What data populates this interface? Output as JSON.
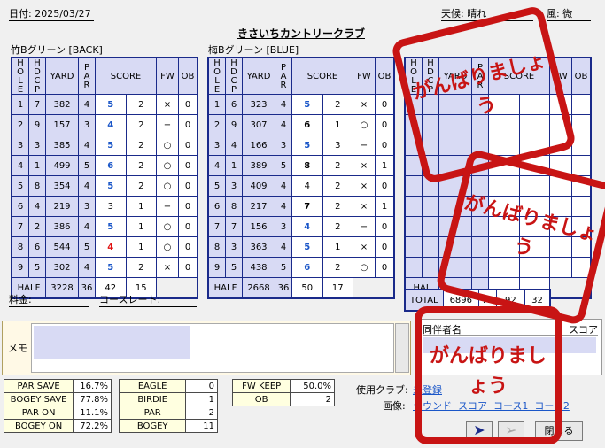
{
  "header": {
    "date_label": "日付: 2025/03/27",
    "title": "きさいちカントリークラブ",
    "weather_label": "天候: 晴れ",
    "wind_label": "風: 微"
  },
  "course1": {
    "name": "竹Bグリーン [BACK]",
    "rows": [
      {
        "hole": "1",
        "hdcp": "7",
        "yard": "382",
        "par": "4",
        "score": "5",
        "putt": "2",
        "fw": "×",
        "ob": "0",
        "score_style": "blue"
      },
      {
        "hole": "2",
        "hdcp": "9",
        "yard": "157",
        "par": "3",
        "score": "4",
        "putt": "2",
        "fw": "−",
        "ob": "0",
        "score_style": "blue"
      },
      {
        "hole": "3",
        "hdcp": "3",
        "yard": "385",
        "par": "4",
        "score": "5",
        "putt": "2",
        "fw": "○",
        "ob": "0",
        "score_style": "blue"
      },
      {
        "hole": "4",
        "hdcp": "1",
        "yard": "499",
        "par": "5",
        "score": "6",
        "putt": "2",
        "fw": "○",
        "ob": "0",
        "score_style": "blue"
      },
      {
        "hole": "5",
        "hdcp": "8",
        "yard": "354",
        "par": "4",
        "score": "5",
        "putt": "2",
        "fw": "○",
        "ob": "0",
        "score_style": "blue"
      },
      {
        "hole": "6",
        "hdcp": "4",
        "yard": "219",
        "par": "3",
        "score": "3",
        "putt": "1",
        "fw": "−",
        "ob": "0",
        "score_style": "plain"
      },
      {
        "hole": "7",
        "hdcp": "2",
        "yard": "386",
        "par": "4",
        "score": "5",
        "putt": "1",
        "fw": "○",
        "ob": "0",
        "score_style": "blue"
      },
      {
        "hole": "8",
        "hdcp": "6",
        "yard": "544",
        "par": "5",
        "score": "4",
        "putt": "1",
        "fw": "○",
        "ob": "0",
        "score_style": "red"
      },
      {
        "hole": "9",
        "hdcp": "5",
        "yard": "302",
        "par": "4",
        "score": "5",
        "putt": "2",
        "fw": "×",
        "ob": "0",
        "score_style": "blue"
      }
    ],
    "half": {
      "label": "HALF",
      "yard": "3228",
      "par": "36",
      "score": "42",
      "putt": "15"
    }
  },
  "course2": {
    "name": "梅Bグリーン [BLUE]",
    "rows": [
      {
        "hole": "1",
        "hdcp": "6",
        "yard": "323",
        "par": "4",
        "score": "5",
        "putt": "2",
        "fw": "×",
        "ob": "0",
        "score_style": "blue"
      },
      {
        "hole": "2",
        "hdcp": "9",
        "yard": "307",
        "par": "4",
        "score": "6",
        "putt": "1",
        "fw": "○",
        "ob": "0",
        "score_style": "navy"
      },
      {
        "hole": "3",
        "hdcp": "4",
        "yard": "166",
        "par": "3",
        "score": "5",
        "putt": "3",
        "fw": "−",
        "ob": "0",
        "score_style": "blue"
      },
      {
        "hole": "4",
        "hdcp": "1",
        "yard": "389",
        "par": "5",
        "score": "8",
        "putt": "2",
        "fw": "×",
        "ob": "1",
        "score_style": "bold"
      },
      {
        "hole": "5",
        "hdcp": "3",
        "yard": "409",
        "par": "4",
        "score": "4",
        "putt": "2",
        "fw": "×",
        "ob": "0",
        "score_style": "plain"
      },
      {
        "hole": "6",
        "hdcp": "8",
        "yard": "217",
        "par": "4",
        "score": "7",
        "putt": "2",
        "fw": "×",
        "ob": "1",
        "score_style": "bold"
      },
      {
        "hole": "7",
        "hdcp": "7",
        "yard": "156",
        "par": "3",
        "score": "4",
        "putt": "2",
        "fw": "−",
        "ob": "0",
        "score_style": "blue"
      },
      {
        "hole": "8",
        "hdcp": "3",
        "yard": "363",
        "par": "4",
        "score": "5",
        "putt": "1",
        "fw": "×",
        "ob": "0",
        "score_style": "blue"
      },
      {
        "hole": "9",
        "hdcp": "5",
        "yard": "438",
        "par": "5",
        "score": "6",
        "putt": "2",
        "fw": "○",
        "ob": "0",
        "score_style": "blue"
      }
    ],
    "half": {
      "label": "HALF",
      "yard": "2668",
      "par": "36",
      "score": "50",
      "putt": "17"
    }
  },
  "columns": {
    "hole": "HOLE",
    "hdcp": "HDCP",
    "yard": "YARD",
    "par": "PAR",
    "score": "SCORE",
    "fw": "FW",
    "ob": "OB"
  },
  "course3": {
    "half_label": "HAL",
    "total_label": "TOTAL",
    "total_yard": "6896",
    "total_par": "72",
    "total_score": "92",
    "total_putt": "32"
  },
  "fees": {
    "fee_label": "料金:",
    "rating_label": "コースレート:"
  },
  "memo": {
    "label": "メモ"
  },
  "companions": {
    "name_header": "同伴者名",
    "score_header": "スコア"
  },
  "stats_left": [
    {
      "label": "PAR SAVE",
      "value": "16.7%"
    },
    {
      "label": "BOGEY SAVE",
      "value": "77.8%"
    },
    {
      "label": "PAR ON",
      "value": "11.1%"
    },
    {
      "label": "BOGEY ON",
      "value": "72.2%"
    }
  ],
  "stats_mid": [
    {
      "label": "EAGLE",
      "value": "0"
    },
    {
      "label": "BIRDIE",
      "value": "1"
    },
    {
      "label": "PAR",
      "value": "2"
    },
    {
      "label": "BOGEY",
      "value": "11"
    }
  ],
  "stats_right": [
    {
      "label": "FW KEEP",
      "value": "50.0%"
    },
    {
      "label": "OB",
      "value": "2"
    }
  ],
  "bottom": {
    "club_label": "使用クラブ:",
    "club_link": "未登録",
    "image_label": "画像:",
    "image_links": "ラウンド  スコア  コース1  コース2",
    "close_label": "閉じる"
  },
  "stamp_text": "がんばりましょう"
}
